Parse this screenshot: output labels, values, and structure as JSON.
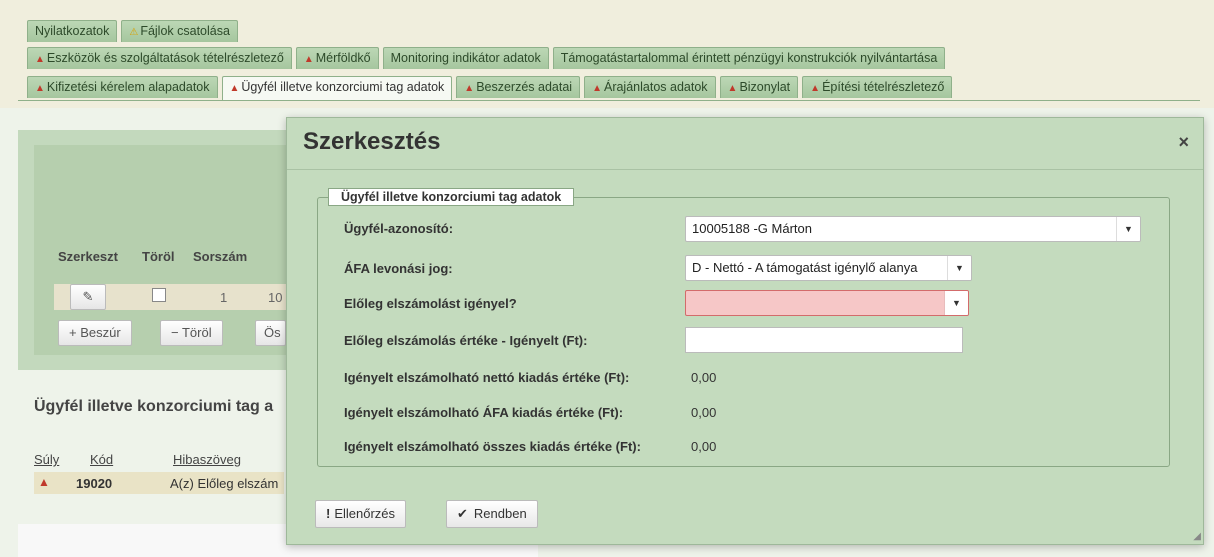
{
  "tabs": {
    "row1": [
      {
        "label": "Nyilatkozatok",
        "warn": false,
        "info": false
      },
      {
        "label": "Fájlok csatolása",
        "warn": false,
        "info": true
      }
    ],
    "row2": [
      {
        "label": "Eszközök és szolgáltatások tételrészletező",
        "warn": true
      },
      {
        "label": "Mérföldkő",
        "warn": true
      },
      {
        "label": "Monitoring indikátor adatok",
        "warn": false
      },
      {
        "label": "Támogatástartalommal érintett pénzügyi konstrukciók nyilvántartása",
        "warn": false
      }
    ],
    "row3": [
      {
        "label": "Kifizetési kérelem alapadatok",
        "warn": true
      },
      {
        "label": "Ügyfél illetve konzorciumi tag adatok",
        "warn": true,
        "active": true
      },
      {
        "label": "Beszerzés adatai",
        "warn": true
      },
      {
        "label": "Árajánlatos adatok",
        "warn": true
      },
      {
        "label": "Bizonylat",
        "warn": true
      },
      {
        "label": "Építési tételrészletező",
        "warn": true
      }
    ]
  },
  "background": {
    "grid_headers": [
      "Szerkeszt",
      "Töröl",
      "Sorszám"
    ],
    "row": {
      "sorszam": "1",
      "partial": "10"
    },
    "buttons": {
      "insert": "+ Beszúr",
      "delete": "− Töröl",
      "partial": "Ös"
    },
    "section_title": "Ügyfél illetve konzorciumi tag a",
    "error_headers": {
      "weight": "Súly",
      "code": "Kód",
      "text": "Hibaszöveg"
    },
    "error_row": {
      "code": "19020",
      "text": "A(z) Előleg elszám"
    }
  },
  "modal": {
    "title": "Szerkesztés",
    "close": "×",
    "legend": "Ügyfél illetve konzorciumi tag adatok",
    "fields": {
      "client_id_label": "Ügyfél-azonosító:",
      "client_id_value": "10005188   -G   Márton",
      "vat_label": "ÁFA levonási jog:",
      "vat_value": "D - Nettó - A támogatást igénylő alanya",
      "advance_label": "Előleg elszámolást igényel?",
      "advance_value": "",
      "advance_amount_label": "Előleg elszámolás értéke - Igényelt (Ft):",
      "net_label": "Igényelt elszámolható nettó kiadás értéke (Ft):",
      "net_value": "0,00",
      "vat_amount_label": "Igényelt elszámolható ÁFA kiadás értéke (Ft):",
      "vat_amount_value": "0,00",
      "total_label": "Igényelt elszámolható összes kiadás értéke (Ft):",
      "total_value": "0,00"
    },
    "buttons": {
      "check": "Ellenőrzés",
      "ok": "Rendben"
    }
  }
}
